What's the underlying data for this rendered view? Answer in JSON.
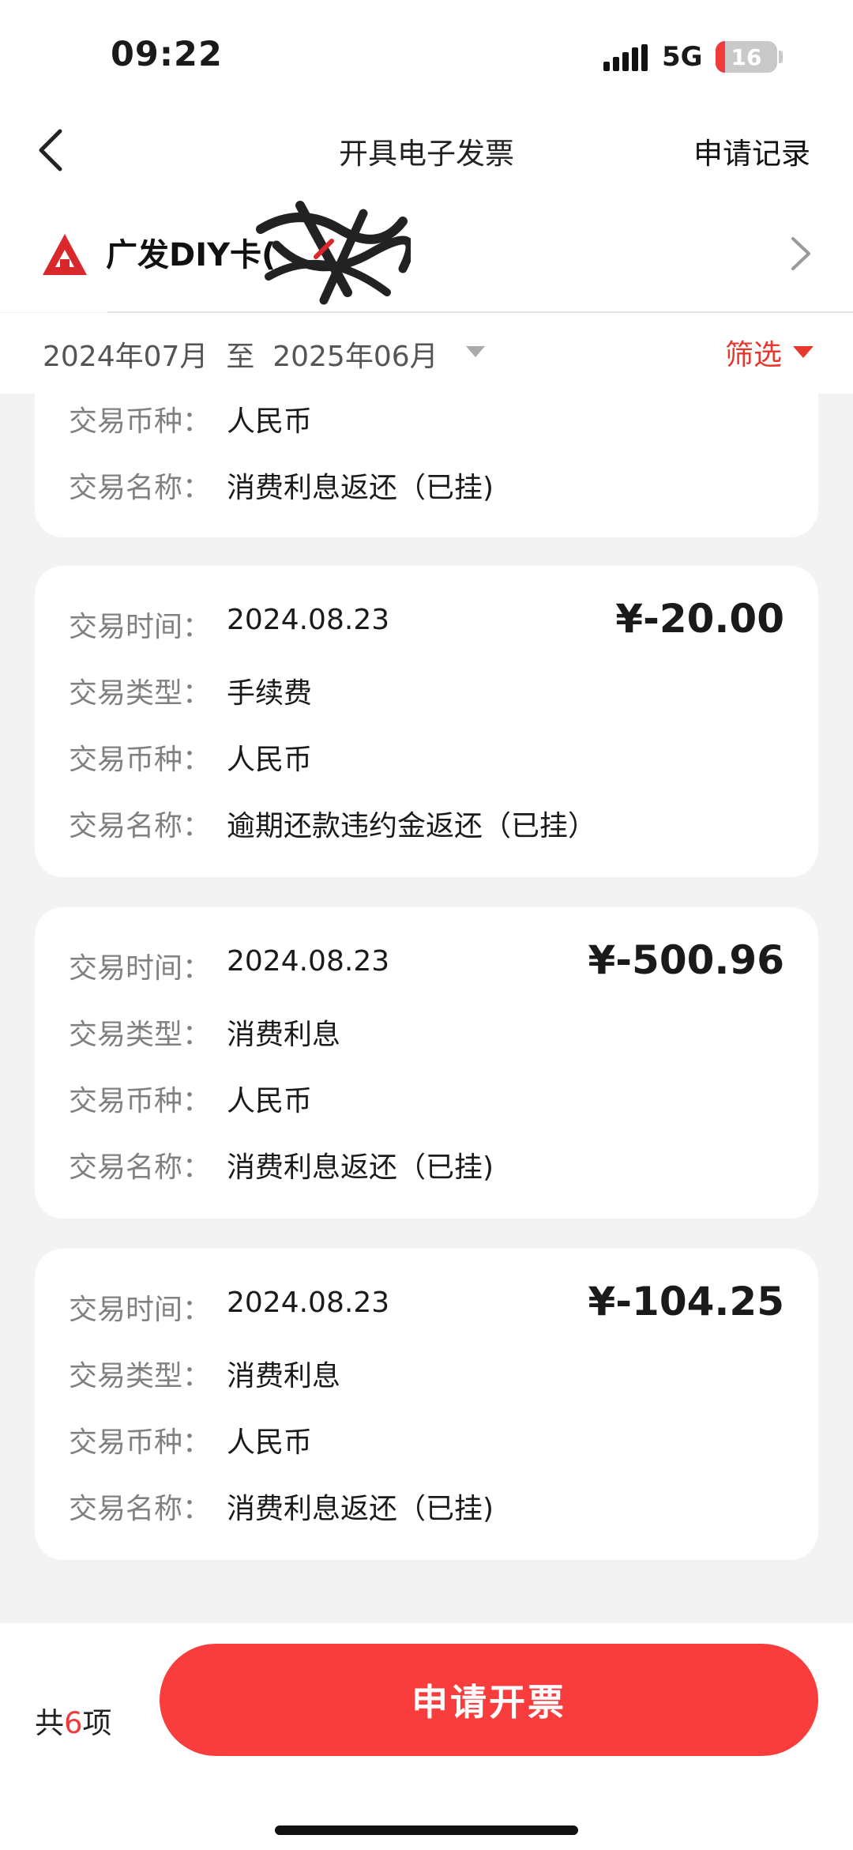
{
  "status_bar": {
    "time": "09:22",
    "network": "5G",
    "battery": "16",
    "battery_level": 0.16,
    "icons": [
      "signal-icon",
      "battery-icon"
    ]
  },
  "nav": {
    "back_icon": "chevron-left-icon",
    "title": "开具电子发票",
    "right_action": "申请记录"
  },
  "card_selector": {
    "logo_icon": "bank-logo-icon",
    "name": "广发DIY卡(",
    "chevron_icon": "chevron-right-icon"
  },
  "filter": {
    "date_range": "2024年07月  至  2025年06月",
    "filter_label": "筛选",
    "accent_color": "#e8382e"
  },
  "labels": {
    "time": "交易时间：",
    "type": "交易类型：",
    "currency": "交易币种：",
    "name": "交易名称："
  },
  "transactions": [
    {
      "currency": "人民币",
      "name": "消费利息返还（已挂)"
    },
    {
      "time": "2024.08.23",
      "amount": "¥-20.00",
      "type": "手续费",
      "currency": "人民币",
      "name": "逾期还款违约金返还（已挂）"
    },
    {
      "time": "2024.08.23",
      "amount": "¥-500.96",
      "type": "消费利息",
      "currency": "人民币",
      "name": "消费利息返还（已挂)"
    },
    {
      "time": "2024.08.23",
      "amount": "¥-104.25",
      "type": "消费利息",
      "currency": "人民币",
      "name": "消费利息返还（已挂)"
    }
  ],
  "footer": {
    "total_prefix": "共",
    "total_count": "6",
    "total_suffix": "项",
    "apply_button": "申请开票",
    "button_color": "#f93d3c"
  }
}
